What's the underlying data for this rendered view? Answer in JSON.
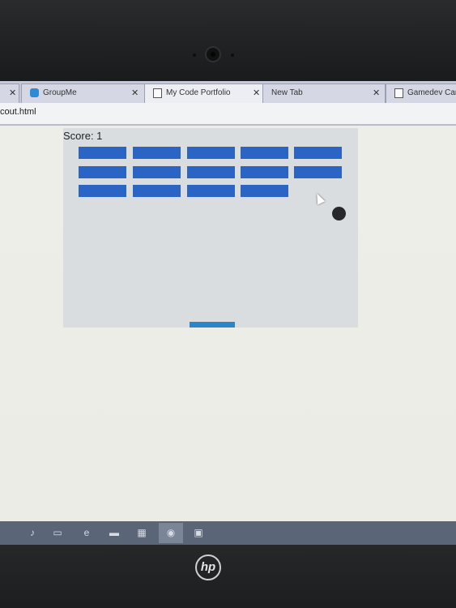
{
  "browser": {
    "tabs": [
      {
        "label": "",
        "icon": "blank-page-icon"
      },
      {
        "label": "GroupMe",
        "icon": "groupme-icon"
      },
      {
        "label": "My Code Portfolio",
        "icon": "document-icon"
      },
      {
        "label": "New Tab",
        "icon": "none"
      },
      {
        "label": "Gamedev Can",
        "icon": "document-icon"
      }
    ],
    "url": "cout.html"
  },
  "game": {
    "score_label": "Score: 1",
    "bricks_per_row": [
      5,
      5,
      4
    ],
    "brick_color": "#2a65c6",
    "paddle_color": "#2c85c8",
    "ball_color": "#26282b",
    "background_color": "#dadddf"
  },
  "taskbar": {
    "items": [
      "microphone-icon",
      "task-view-icon",
      "edge-icon",
      "file-explorer-icon",
      "store-icon",
      "chrome-icon",
      "app-icon"
    ]
  },
  "hardware": {
    "logo_text": "hp"
  }
}
